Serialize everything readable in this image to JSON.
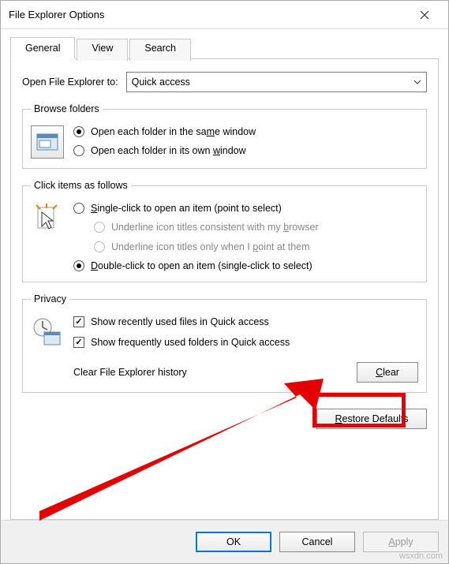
{
  "window": {
    "title": "File Explorer Options"
  },
  "tabs": {
    "general": "General",
    "view": "View",
    "search": "Search"
  },
  "open_to": {
    "label": "Open File Explorer to:",
    "value": "Quick access"
  },
  "browse": {
    "legend": "Browse folders",
    "opt_same": "Open each folder in the same window",
    "opt_own": "Open each folder in its own window",
    "selected": "same"
  },
  "click_items": {
    "legend": "Click items as follows",
    "single": "Single-click to open an item (point to select)",
    "underline_browser": "Underline icon titles consistent with my browser",
    "underline_point": "Underline icon titles only when I point at them",
    "double": "Double-click to open an item (single-click to select)",
    "selected": "double"
  },
  "privacy": {
    "legend": "Privacy",
    "show_recent": "Show recently used files in Quick access",
    "show_frequent": "Show frequently used folders in Quick access",
    "clear_label": "Clear File Explorer history",
    "clear_button": "Clear",
    "recent_checked": true,
    "frequent_checked": true
  },
  "buttons": {
    "restore_defaults": "Restore Defaults",
    "ok": "OK",
    "cancel": "Cancel",
    "apply": "Apply"
  },
  "watermark": "wsxdn.com"
}
